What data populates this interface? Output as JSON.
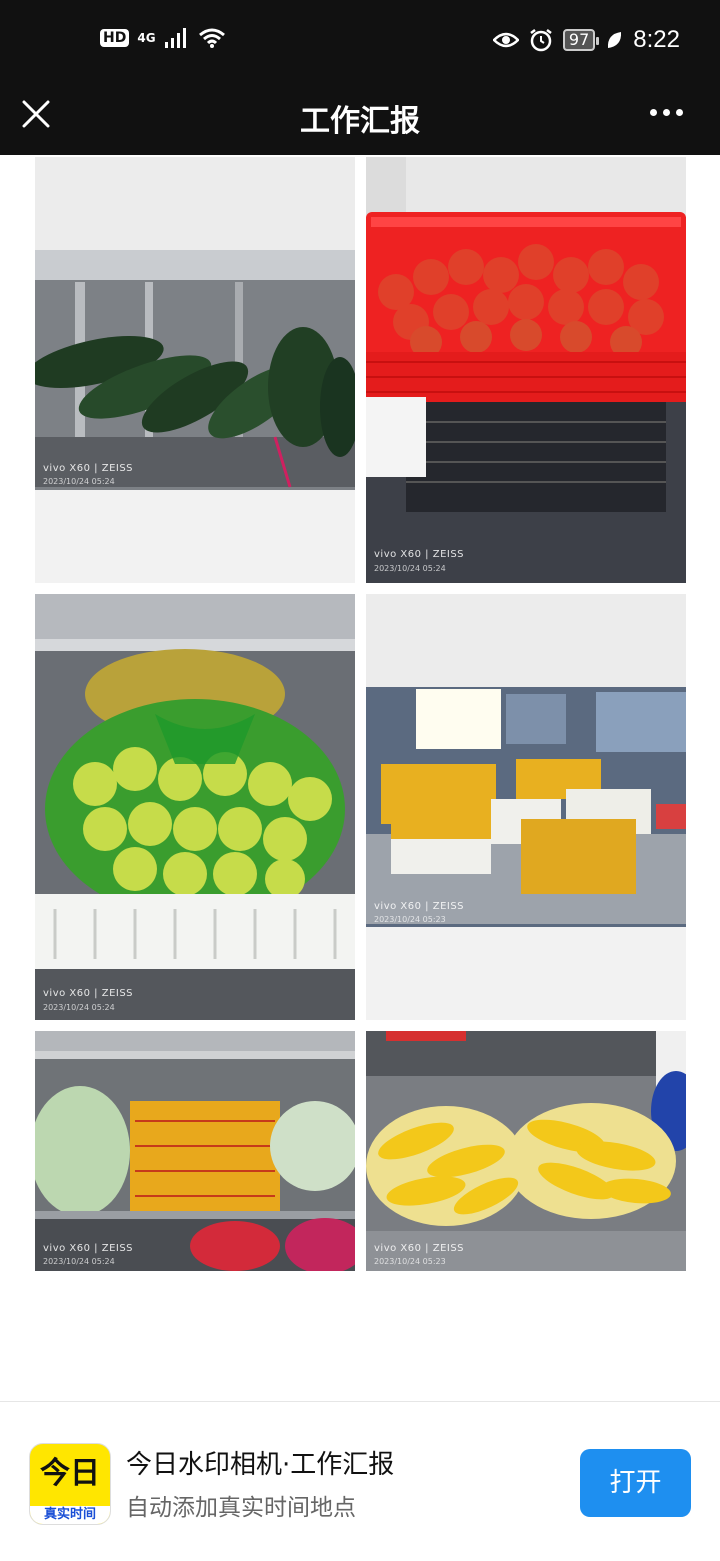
{
  "status_bar": {
    "hd": "HD",
    "network": "4G",
    "battery": "97",
    "time": "8:22",
    "icons": [
      "hd-icon",
      "signal-icon",
      "wifi-icon",
      "eye-icon",
      "alarm-icon",
      "battery-icon",
      "leaf-icon"
    ]
  },
  "nav": {
    "title": "工作汇报",
    "close_icon": "close-icon",
    "more_icon": "more-icon"
  },
  "photos": [
    {
      "watermark": "vivo X60 | ZEISS",
      "date": "2023/10/24 05:24"
    },
    {
      "watermark": "vivo X60 | ZEISS",
      "date": "2023/10/24 05:24"
    },
    {
      "watermark": "vivo X60 | ZEISS",
      "date": "2023/10/24 05:24"
    },
    {
      "watermark": "vivo X60 | ZEISS",
      "date": "2023/10/24 05:23"
    },
    {
      "watermark": "vivo X60 | ZEISS",
      "date": "2023/10/24 05:24"
    },
    {
      "watermark": "vivo X60 | ZEISS",
      "date": "2023/10/24 05:23"
    }
  ],
  "banner": {
    "icon_main": "今日",
    "icon_sub": "真实时间",
    "app_name": "今日水印相机·工作汇报",
    "app_desc": "自动添加真实时间地点",
    "open_label": "打开"
  }
}
